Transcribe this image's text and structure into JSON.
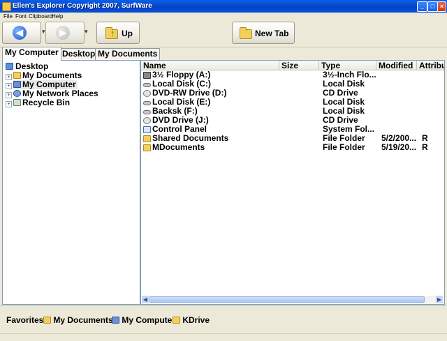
{
  "window": {
    "title": "Ellen's Explorer Copyright 2007, SurfWare"
  },
  "menu": [
    "File",
    "Font",
    "Clipboard",
    "Help"
  ],
  "toolbar": {
    "up_label": "Up",
    "new_tab_label": "New Tab"
  },
  "tabs": [
    "My Computer",
    "Desktop",
    "My Documents"
  ],
  "tree": [
    {
      "label": "Desktop",
      "icon": "desktop-icon"
    },
    {
      "label": "My Documents",
      "icon": "folder-icon"
    },
    {
      "label": "My Computer",
      "icon": "computer-icon"
    },
    {
      "label": "My Network Places",
      "icon": "network-icon"
    },
    {
      "label": "Recycle Bin",
      "icon": "recycle-bin-icon"
    }
  ],
  "columns": [
    "Name",
    "Size",
    "Type",
    "Modified",
    "Attribu"
  ],
  "files": [
    {
      "name": "3½ Floppy (A:)",
      "size": "",
      "type": "3½-Inch Flo...",
      "modified": "",
      "attr": "",
      "icon": "floppy-icon"
    },
    {
      "name": "Local Disk (C:)",
      "size": "",
      "type": "Local Disk",
      "modified": "",
      "attr": "",
      "icon": "drive-icon"
    },
    {
      "name": "DVD-RW Drive (D:)",
      "size": "",
      "type": "CD Drive",
      "modified": "",
      "attr": "",
      "icon": "cd-icon"
    },
    {
      "name": "Local Disk (E:)",
      "size": "",
      "type": "Local Disk",
      "modified": "",
      "attr": "",
      "icon": "drive-icon"
    },
    {
      "name": "Backsk (F:)",
      "size": "",
      "type": "Local Disk",
      "modified": "",
      "attr": "",
      "icon": "drive-icon"
    },
    {
      "name": "DVD Drive (J:)",
      "size": "",
      "type": "CD Drive",
      "modified": "",
      "attr": "",
      "icon": "cd-icon"
    },
    {
      "name": "Control Panel",
      "size": "",
      "type": "System Fol...",
      "modified": "",
      "attr": "",
      "icon": "control-panel-icon"
    },
    {
      "name": "Shared Documents",
      "size": "",
      "type": "File Folder",
      "modified": "5/2/200...",
      "attr": "R",
      "icon": "folder-icon"
    },
    {
      "name": "MDocuments",
      "size": "",
      "type": "File Folder",
      "modified": "5/19/20...",
      "attr": "R",
      "icon": "folder-icon"
    }
  ],
  "favorites": {
    "label": "Favorites",
    "items": [
      {
        "label": "My Documents",
        "icon": "documents-icon"
      },
      {
        "label": "My Computer",
        "icon": "computer-icon"
      },
      {
        "label": "KDrive",
        "icon": "folder-icon"
      }
    ]
  },
  "colors": {
    "titlebar": "#0a5fe6",
    "selection": "#e8e8e8",
    "back_button": "#2f6fd8"
  }
}
